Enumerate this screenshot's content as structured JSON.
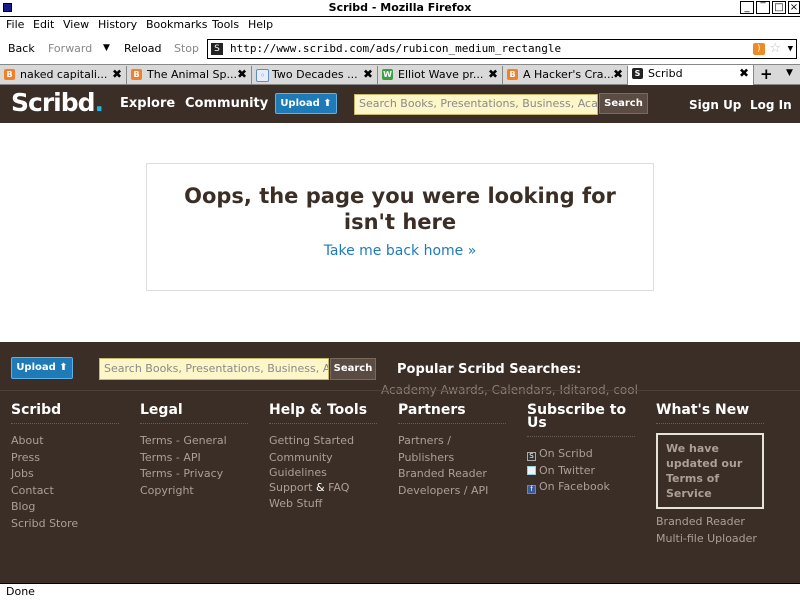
{
  "window": {
    "title": "Scribd - Mozilla Firefox"
  },
  "menu": [
    "File",
    "Edit",
    "View",
    "History",
    "Bookmarks",
    "Tools",
    "Help"
  ],
  "nav": {
    "back": "Back",
    "forward": "Forward",
    "reload": "Reload",
    "stop": "Stop",
    "url": "http://www.scribd.com/ads/rubicon_medium_rectangle"
  },
  "tabs": [
    {
      "label": "naked capitali...",
      "icon": "blogger-icon",
      "color": "#f0802a"
    },
    {
      "label": "The Animal Sp...",
      "icon": "blogger-icon",
      "color": "#f0802a"
    },
    {
      "label": "Two Decades ...",
      "icon": "page-icon",
      "color": "#5a8fc8"
    },
    {
      "label": "Elliot Wave pr...",
      "icon": "w-icon",
      "color": "#3aa040"
    },
    {
      "label": "A Hacker's Cra...",
      "icon": "blogger-icon",
      "color": "#f0802a"
    },
    {
      "label": "Scribd",
      "icon": "scribd-icon",
      "color": "#222222"
    }
  ],
  "header": {
    "logo": "Scribd",
    "explore": "Explore",
    "community": "Community",
    "upload": "Upload",
    "search_placeholder": "Search Books, Presentations, Business, Academics...",
    "search_button": "Search",
    "sign_up": "Sign Up",
    "log_in": "Log In"
  },
  "main": {
    "message": "Oops, the page you were looking for isn't here",
    "home_link": "Take me back home »"
  },
  "footer": {
    "upload": "Upload",
    "search_placeholder": "Search Books, Presentations, Business, Academics...",
    "search_button": "Search",
    "popular_title": "Popular Scribd Searches:",
    "popular_terms": "Academy Awards, Calendars, Iditarod, cool",
    "scribd": {
      "title": "Scribd",
      "links": [
        "About",
        "Press",
        "Jobs",
        "Contact",
        "Blog",
        "Scribd Store"
      ]
    },
    "legal": {
      "title": "Legal",
      "links": [
        "Terms - General",
        "Terms - API",
        "Terms - Privacy",
        "Copyright"
      ]
    },
    "help": {
      "title": "Help & Tools",
      "links": [
        "Getting Started",
        "Community Guidelines"
      ],
      "support": "Support",
      "amp": "&",
      "faq": "FAQ",
      "webstuff": "Web Stuff"
    },
    "partners": {
      "title": "Partners",
      "links": [
        "Partners / Publishers",
        "Branded Reader",
        "Developers / API"
      ]
    },
    "subscribe": {
      "title": "Subscribe to Us",
      "links": [
        "On Scribd",
        "On Twitter",
        "On Facebook"
      ]
    },
    "whatsnew": {
      "title": "What's New",
      "box": "We have updated our Terms of Service",
      "links": [
        "Branded Reader",
        "Multi-file Uploader"
      ]
    }
  },
  "status": "Done",
  "colors": {
    "brand_dark": "#3a2e26",
    "link_blue": "#1f7ab8",
    "search_bg": "#fdf6c8"
  }
}
